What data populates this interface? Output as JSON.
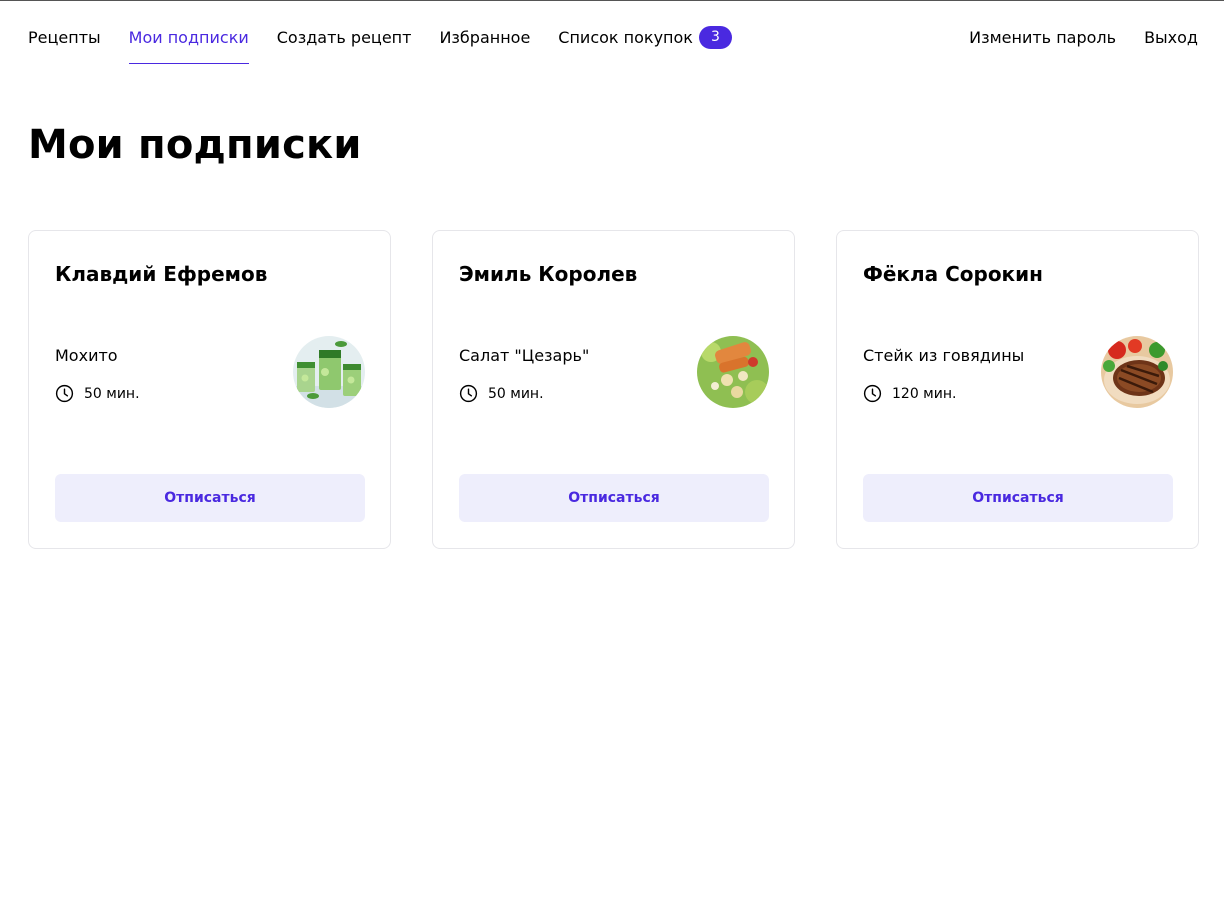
{
  "nav": {
    "items": [
      {
        "label": "Рецепты"
      },
      {
        "label": "Мои подписки"
      },
      {
        "label": "Создать рецепт"
      },
      {
        "label": "Избранное"
      },
      {
        "label": "Список покупок",
        "badge": "3"
      }
    ],
    "active_item": "Мои подписки",
    "right": {
      "change_password": "Изменить пароль",
      "logout": "Выход"
    }
  },
  "page": {
    "title": "Мои подписки"
  },
  "subscriptions": [
    {
      "author": "Клавдий Ефремов",
      "recipe": {
        "name": "Мохито",
        "time": "50 мин.",
        "image": "mojito-glasses"
      },
      "button": "Отписаться"
    },
    {
      "author": "Эмиль Королев",
      "recipe": {
        "name": "Салат \"Цезарь\"",
        "time": "50 мин.",
        "image": "caesar-salad"
      },
      "button": "Отписаться"
    },
    {
      "author": "Фёкла Сорокин",
      "recipe": {
        "name": "Стейк из говядины",
        "time": "120 мин.",
        "image": "beef-steak"
      },
      "button": "Отписаться"
    }
  ],
  "colors": {
    "accent": "#4A29E0",
    "button_bg": "#EEEEFC",
    "card_border": "#E6E6EA"
  }
}
